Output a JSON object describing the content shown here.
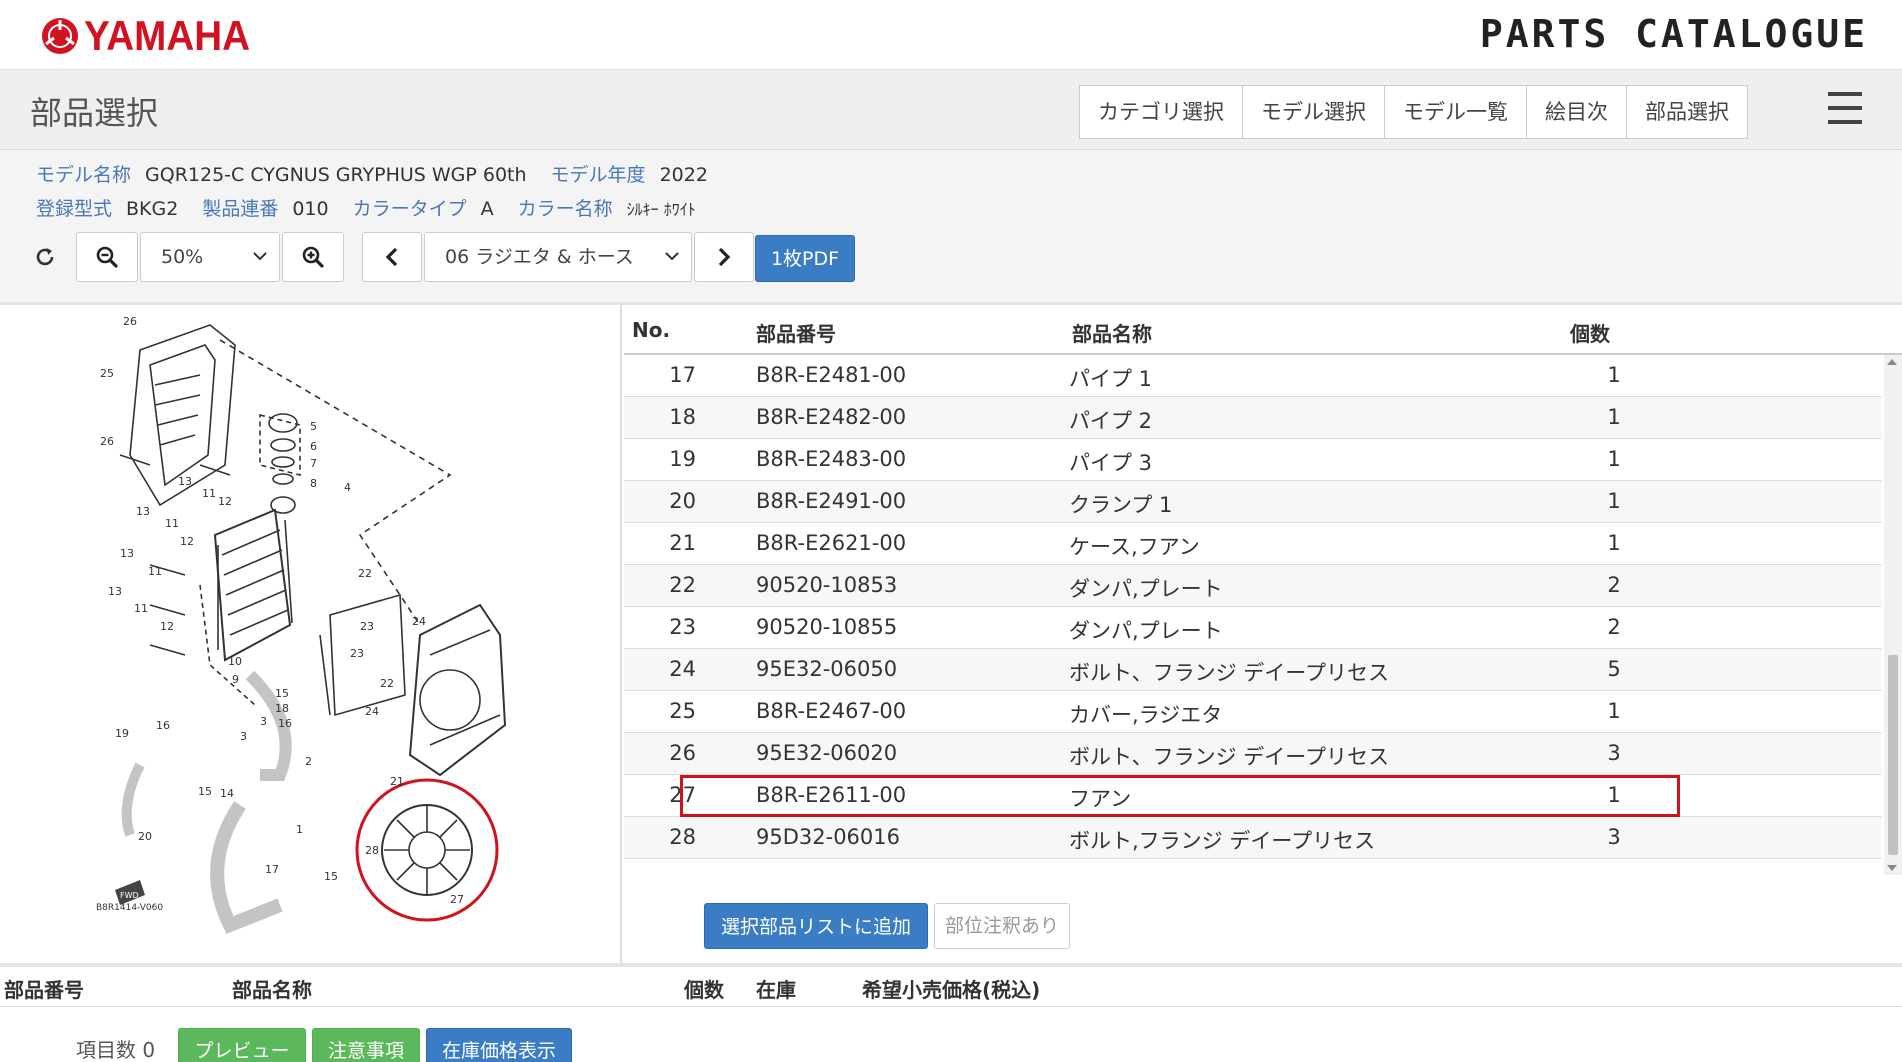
{
  "header": {
    "brand": "YAMAHA",
    "catalogue_title": "PARTS CATALOGUE"
  },
  "title_bar": {
    "page_title": "部品選択",
    "tabs": [
      {
        "label": "カテゴリ選択"
      },
      {
        "label": "モデル選択"
      },
      {
        "label": "モデル一覧"
      },
      {
        "label": "絵目次"
      },
      {
        "label": "部品選択"
      }
    ]
  },
  "model_info": {
    "model_name_label": "モデル名称",
    "model_name": "GQR125-C CYGNUS GRYPHUS WGP 60th",
    "model_year_label": "モデル年度",
    "model_year": "2022",
    "reg_type_label": "登録型式",
    "reg_type": "BKG2",
    "serial_label": "製品連番",
    "serial": "010",
    "color_type_label": "カラータイプ",
    "color_type": "A",
    "color_name_label": "カラー名称",
    "color_name": "ｼﾙｷｰ ﾎﾜｲﾄ"
  },
  "toolbar": {
    "zoom_value": "50%",
    "diagram_select": "06 ラジエタ & ホース",
    "pdf_label": "1枚PDF"
  },
  "diagram": {
    "code": "B8R1414-V060",
    "fwd_label": "FWD"
  },
  "parts_table": {
    "headers": {
      "no": "No.",
      "part_number": "部品番号",
      "part_name": "部品名称",
      "qty": "個数"
    },
    "rows": [
      {
        "no": "17",
        "part_number": "B8R-E2481-00",
        "name": "パイプ 1",
        "qty": "1"
      },
      {
        "no": "18",
        "part_number": "B8R-E2482-00",
        "name": "パイプ 2",
        "qty": "1"
      },
      {
        "no": "19",
        "part_number": "B8R-E2483-00",
        "name": "パイプ 3",
        "qty": "1"
      },
      {
        "no": "20",
        "part_number": "B8R-E2491-00",
        "name": "クランプ 1",
        "qty": "1"
      },
      {
        "no": "21",
        "part_number": "B8R-E2621-00",
        "name": "ケース,フアン",
        "qty": "1"
      },
      {
        "no": "22",
        "part_number": "90520-10853",
        "name": "ダンパ,プレート",
        "qty": "2"
      },
      {
        "no": "23",
        "part_number": "90520-10855",
        "name": "ダンパ,プレート",
        "qty": "2"
      },
      {
        "no": "24",
        "part_number": "95E32-06050",
        "name": "ボルト、フランジ デイープリセス",
        "qty": "5"
      },
      {
        "no": "25",
        "part_number": "B8R-E2467-00",
        "name": "カバー,ラジエタ",
        "qty": "1"
      },
      {
        "no": "26",
        "part_number": "95E32-06020",
        "name": "ボルト、フランジ デイープリセス",
        "qty": "3"
      },
      {
        "no": "27",
        "part_number": "B8R-E2611-00",
        "name": "フアン",
        "qty": "1"
      },
      {
        "no": "28",
        "part_number": "95D32-06016",
        "name": "ボルト,フランジ デイープリセス",
        "qty": "3"
      }
    ],
    "add_button": "選択部品リストに追加",
    "note_button": "部位注釈あり"
  },
  "selected_list": {
    "headers": {
      "part_number": "部品番号",
      "part_name": "部品名称",
      "qty": "個数",
      "stock": "在庫",
      "price": "希望小売価格(税込)"
    },
    "item_count_label": "項目数",
    "item_count": "0",
    "preview_button": "プレビュー",
    "notes_button": "注意事項",
    "stock_price_button": "在庫価格表示"
  },
  "colors": {
    "brand_red": "#d11220",
    "link_blue": "#4a77b5",
    "primary_blue": "#3a7dc4",
    "success_green": "#5cb85c",
    "highlight_red": "#d0121b"
  }
}
